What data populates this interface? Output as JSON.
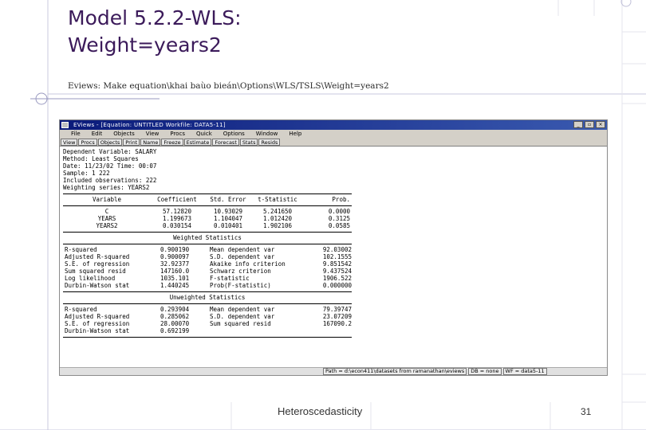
{
  "slide": {
    "title_line1": "Model 5.2.2-WLS:",
    "title_line2": "Weight=years2",
    "subtitle": "Eviews: Make equation\\khai baùo bieán\\Options\\WLS/TSLS\\Weight=years2",
    "footer_text": "Heteroscedasticity",
    "page_number": "31"
  },
  "window": {
    "title": "EViews - [Equation: UNTITLED   Workfile: DATA5-11]",
    "controls": [
      "_",
      "▫",
      "×"
    ],
    "menu": [
      "File",
      "Edit",
      "Objects",
      "View",
      "Procs",
      "Quick",
      "Options",
      "Window",
      "Help"
    ],
    "toolbar": [
      "View",
      "Procs",
      "Objects",
      "Print",
      "Name",
      "Freeze",
      "Estimate",
      "Forecast",
      "Stats",
      "Resids"
    ],
    "status": [
      "Path = d:\\econ411\\datasets from ramanathan\\eviews",
      "DB = none",
      "WF = data5-11"
    ]
  },
  "output": {
    "header": [
      "Dependent Variable: SALARY",
      "Method: Least Squares",
      "Date: 11/23/02   Time: 00:07",
      "Sample: 1 222",
      "Included observations: 222",
      "Weighting series: YEARS2"
    ],
    "columns": [
      "Variable",
      "Coefficient",
      "Std. Error",
      "t-Statistic",
      "Prob."
    ],
    "coefficients": [
      {
        "var": "C",
        "coef": "57.12820",
        "se": "10.93029",
        "t": "5.241650",
        "p": "0.0000"
      },
      {
        "var": "YEARS",
        "coef": "1.199673",
        "se": "1.104047",
        "t": "1.012420",
        "p": "0.3125"
      },
      {
        "var": "YEARS2",
        "coef": "0.030154",
        "se": "0.010401",
        "t": "1.902106",
        "p": "0.0585"
      }
    ],
    "weighted_title": "Weighted Statistics",
    "weighted": [
      [
        "R-squared",
        "0.900190",
        "Mean dependent var",
        "92.03002"
      ],
      [
        "Adjusted R-squared",
        "0.900097",
        "S.D. dependent var",
        "102.1555"
      ],
      [
        "S.E. of regression",
        "32.92377",
        "Akaike info criterion",
        "9.851542"
      ],
      [
        "Sum squared resid",
        "147160.0",
        "Schwarz criterion",
        "9.437524"
      ],
      [
        "Log likelihood",
        "1035.101",
        "F-statistic",
        "1906.522"
      ],
      [
        "Durbin-Watson stat",
        "1.440245",
        "Prob(F-statistic)",
        "0.000000"
      ]
    ],
    "unweighted_title": "Unweighted Statistics",
    "unweighted": [
      [
        "R-squared",
        "0.293904",
        "Mean dependent var",
        "79.39747"
      ],
      [
        "Adjusted R-squared",
        "0.285062",
        "S.D. dependent var",
        "23.07209"
      ],
      [
        "S.E. of regression",
        "28.00070",
        "Sum squared resid",
        "167090.2"
      ],
      [
        "Durbin-Watson stat",
        "0.692199",
        "",
        ""
      ]
    ]
  }
}
